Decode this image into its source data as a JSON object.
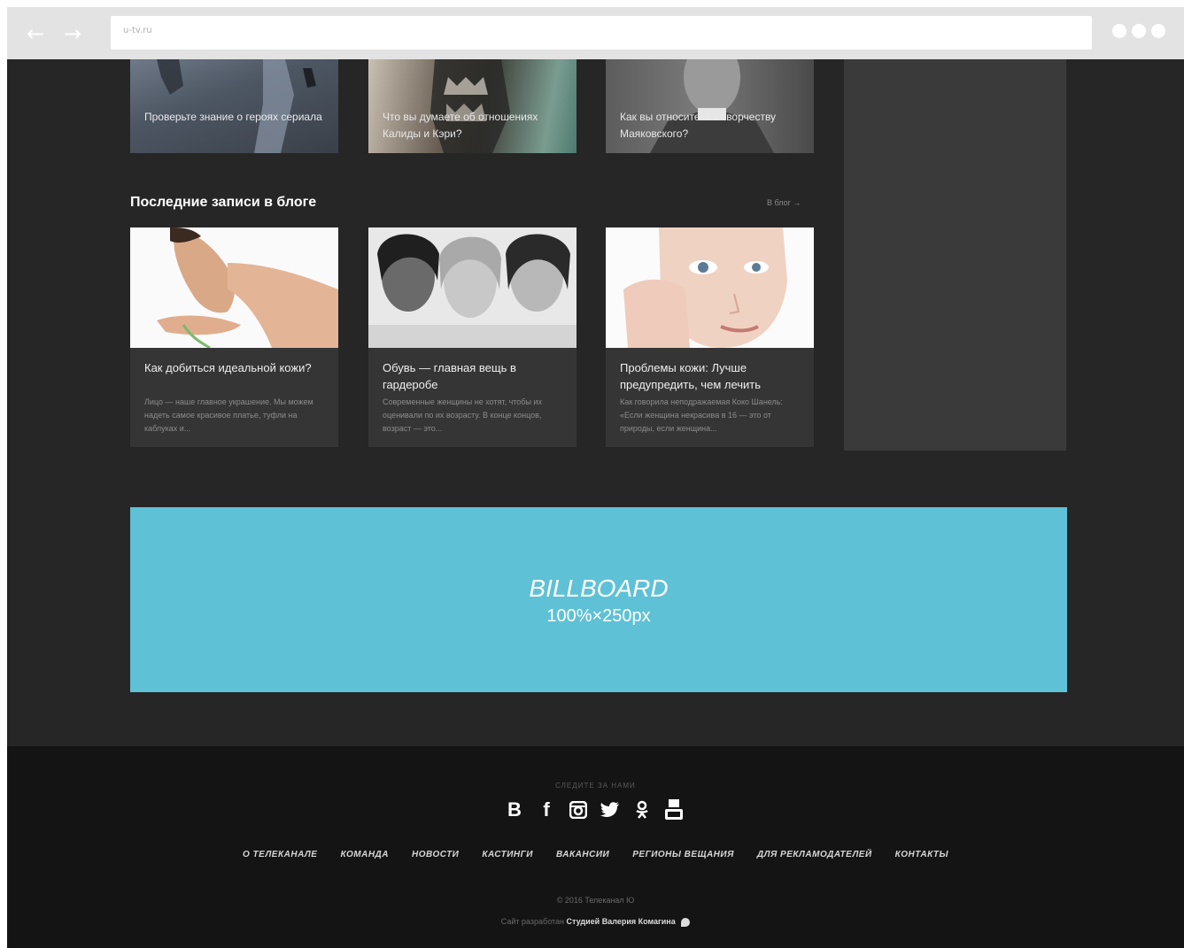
{
  "browser": {
    "url": "u-tv.ru"
  },
  "top_cards": [
    {
      "caption": "Проверьте знание о героях сериала"
    },
    {
      "caption": "Что вы думаете об отношениях Калиды и Кэри?"
    },
    {
      "caption": "Как вы относитесь к творчеству Маяковского?"
    }
  ],
  "blog": {
    "title": "Последние записи в блоге",
    "all_link": "В блог →",
    "posts": [
      {
        "title": "Как добиться идеальной кожи?",
        "excerpt": "Лицо — наше главное украшение. Мы можем надеть самое красивое платье, туфли на каблуках и..."
      },
      {
        "title": "Обувь — главная вещь в гардеробе",
        "excerpt": "Современные женщины не хотят, чтобы их оценивали по их возрасту. В конце концов, возраст — это..."
      },
      {
        "title": "Проблемы кожи: Лучше предупредить, чем лечить",
        "excerpt": "Как говорила неподражаемая Коко Шанель: «Если женщина некрасива в 16 — это от природы, если женщина..."
      }
    ]
  },
  "billboard": {
    "title": "BILLBOARD",
    "size": "100%×250px"
  },
  "footer": {
    "follow_label": "СЛЕДИТЕ ЗА НАМИ",
    "socials": [
      "В",
      "f",
      "instagram",
      "twitter",
      "odnoklassniki",
      "youtube"
    ],
    "nav": [
      "О ТЕЛЕКАНАЛЕ",
      "КОМАНДА",
      "НОВОСТИ",
      "КАСТИНГИ",
      "ВАКАНСИИ",
      "РЕГИОНЫ ВЕЩАНИЯ",
      "ДЛЯ РЕКЛАМОДАТЕЛЕЙ",
      "КОНТАКТЫ"
    ],
    "copyright": "© 2016 Телеканал Ю",
    "dev_prefix": "Сайт разработан",
    "dev_name": "Студией Валерия Комагина"
  },
  "colors": {
    "page_bg": "#262626",
    "card_bg": "#353535",
    "billboard": "#5ec1d6",
    "footer_bg": "#141414"
  }
}
